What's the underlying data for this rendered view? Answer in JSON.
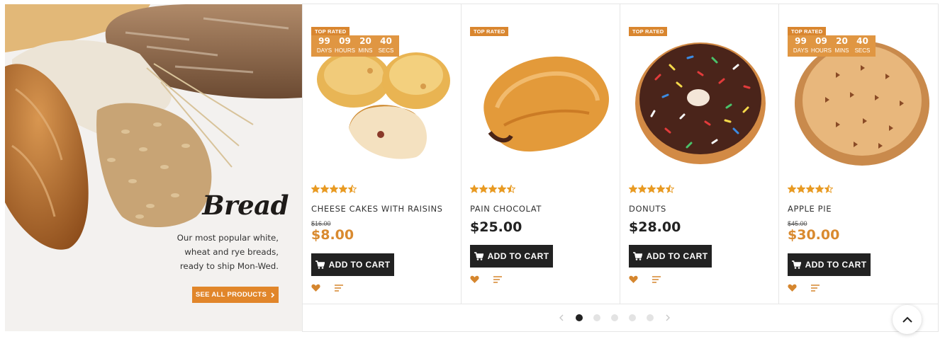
{
  "banner": {
    "title": "Bread",
    "description_lines": [
      "Our most popular white,",
      "wheat and rye breads,",
      "ready to ship Mon-Wed."
    ],
    "button_label": "SEE ALL PRODUCTS"
  },
  "cart_label": "ADD TO CART",
  "countdown_labels": {
    "days": "DAYS",
    "hours": "HOURS",
    "mins": "MINS",
    "secs": "SECS"
  },
  "products": [
    {
      "badge": "TOP RATED",
      "countdown": {
        "days": "99",
        "hours": "09",
        "mins": "20",
        "secs": "40"
      },
      "rating": 4.5,
      "name": "CHEESE CAKES WITH RAISINS",
      "old_price": "$16.00",
      "price": "$8.00",
      "image_icon": "cheese-cakes-image"
    },
    {
      "badge": "TOP RATED",
      "rating": 4.5,
      "name": "PAIN CHOCOLAT",
      "price": "$25.00",
      "image_icon": "pain-chocolat-image"
    },
    {
      "badge": "TOP RATED",
      "rating": 4.5,
      "name": "DONUTS",
      "price": "$28.00",
      "image_icon": "donut-image"
    },
    {
      "badge": "TOP RATED",
      "countdown": {
        "days": "99",
        "hours": "09",
        "mins": "20",
        "secs": "40"
      },
      "rating": 4.5,
      "name": "APPLE PIE",
      "old_price": "$45.00",
      "price": "$30.00",
      "image_icon": "apple-pie-image"
    }
  ],
  "carousel": {
    "pages": 5,
    "active_page": 1
  },
  "colors": {
    "accent": "#e1862a",
    "star": "#e89a22",
    "dark": "#222222"
  }
}
